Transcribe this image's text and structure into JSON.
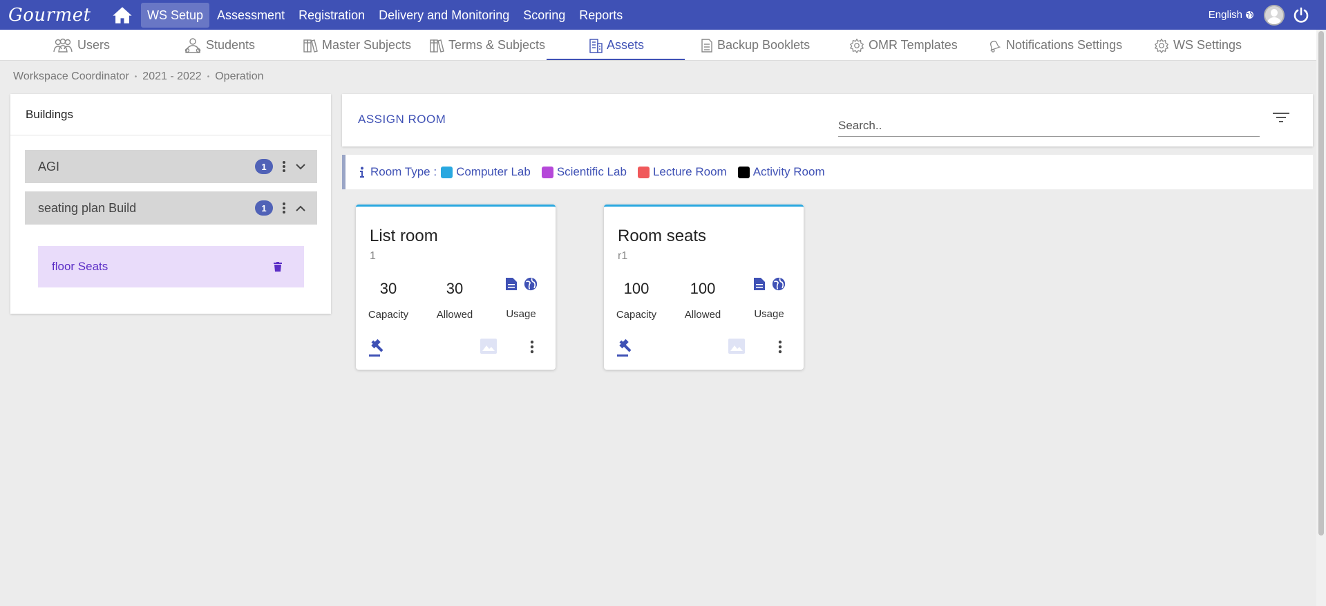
{
  "app": {
    "logo": "Gourmet"
  },
  "topnav": {
    "items": [
      "WS Setup",
      "Assessment",
      "Registration",
      "Delivery and Monitoring",
      "Scoring",
      "Reports"
    ],
    "active": "WS Setup",
    "language": "English"
  },
  "subtabs": [
    {
      "label": "Users",
      "icon": "users-icon"
    },
    {
      "label": "Students",
      "icon": "students-icon"
    },
    {
      "label": "Master Subjects",
      "icon": "books-icon"
    },
    {
      "label": "Terms & Subjects",
      "icon": "books-icon"
    },
    {
      "label": "Assets",
      "icon": "building-icon",
      "active": true
    },
    {
      "label": "Backup Booklets",
      "icon": "document-icon"
    },
    {
      "label": "OMR Templates",
      "icon": "gear-icon"
    },
    {
      "label": "Notifications Settings",
      "icon": "bell-icon"
    },
    {
      "label": "WS Settings",
      "icon": "gear-icon"
    }
  ],
  "breadcrumb": [
    "Workspace Coordinator",
    "2021 - 2022",
    "Operation"
  ],
  "buildings": {
    "title": "Buildings",
    "items": [
      {
        "name": "AGI",
        "count": "1",
        "expanded": false
      },
      {
        "name": "seating plan Build",
        "count": "1",
        "expanded": true,
        "floors": [
          {
            "name": "floor Seats"
          }
        ]
      }
    ]
  },
  "assign": {
    "title": "ASSIGN ROOM",
    "search_placeholder": "Search.."
  },
  "legend": {
    "label": "Room Type :",
    "types": [
      {
        "name": "Computer Lab",
        "color": "#29a8e0"
      },
      {
        "name": "Scientific Lab",
        "color": "#b548d9"
      },
      {
        "name": "Lecture Room",
        "color": "#f0595b"
      },
      {
        "name": "Activity Room",
        "color": "#000000"
      }
    ]
  },
  "rooms": [
    {
      "name": "List room",
      "code": "1",
      "capacity": "30",
      "allowed": "30",
      "capacity_label": "Capacity",
      "allowed_label": "Allowed",
      "usage_label": "Usage"
    },
    {
      "name": "Room seats",
      "code": "r1",
      "capacity": "100",
      "allowed": "100",
      "capacity_label": "Capacity",
      "allowed_label": "Allowed",
      "usage_label": "Usage"
    }
  ],
  "colors": {
    "primary": "#3f51b5",
    "floor_bg": "#e9dcfa",
    "floor_text": "#5b2ec6",
    "card_accent": "#29a8e0"
  }
}
